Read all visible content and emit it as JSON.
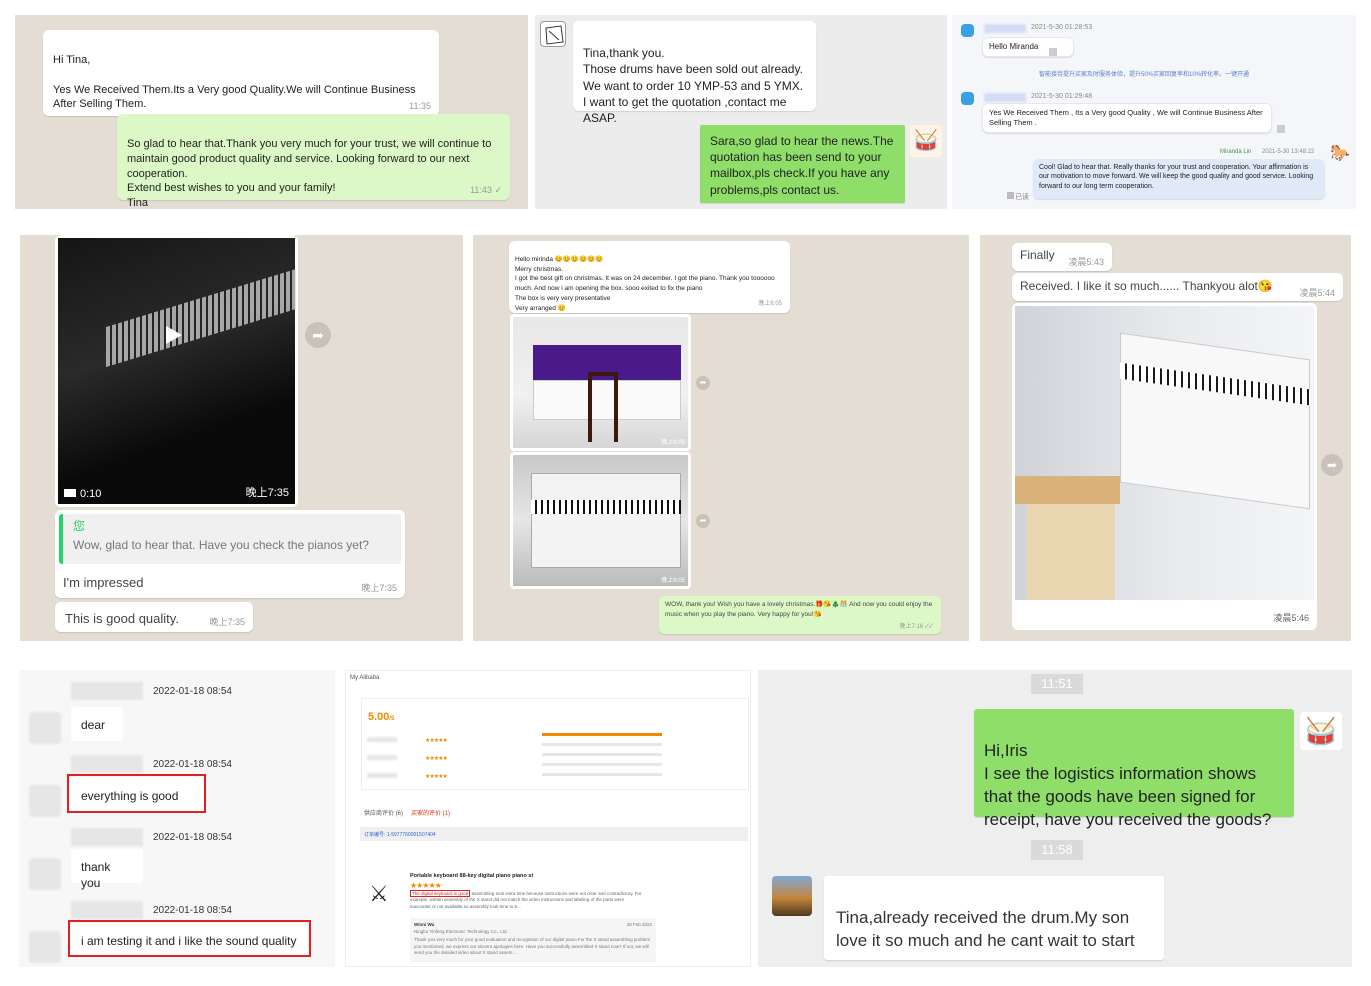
{
  "p1": {
    "in_text": "Hi Tina,\n\nYes We Received Them.Its a Very good Quality.We will Continue Business After Selling Them.",
    "in_time": "11:35",
    "out_text": "So glad to hear that.Thank you very much for your trust, we will continue to maintain good product quality and service. Looking forward to our next cooperation.\nExtend best wishes to you and your family!\nTina",
    "out_time": "11:43 ✓"
  },
  "p2": {
    "in_text": "Tina,thank you.\nThose drums have been sold out already.\nWe want to order 10 YMP-53 and 5 YMX.\nI want to get the quotation ,contact me ASAP.",
    "out_text": "Sara,so glad to hear the news.The quotation has been send to your mailbox,pls check.If you have any problems,pls contact us."
  },
  "p3": {
    "t1": "2021-5-30 01:28:53",
    "m1": "Hello Miranda",
    "note": "智能接待提升买家及时服务体验，提升50%买家回复率和10%转化率。一键开通",
    "t2": "2021-5-30 01:29:48",
    "m2": "Yes We Received Them , Its a Very good Quality , We will Continue Business After Selling Them .",
    "reply_name": "Miranda Lin",
    "t3": "2021-5-30 13:48:22",
    "reply": "Cool! Glad to hear that. Really thanks for your trust and cooperation. Your affirmation is our motivation to move forward. We will keep the good quality and good service. Looking forward to our long term cooperation.",
    "read": "已读"
  },
  "p4": {
    "duration": "0:10",
    "video_time": "晚上7:35",
    "quote_name": "您",
    "quote_text": "Wow, glad to hear that. Have you check the pianos yet?",
    "reply1": "I'm impressed",
    "reply1_time": "晚上7:35",
    "reply2": "This is good quality.",
    "reply2_time": "晚上7:35"
  },
  "p5": {
    "msg": "Hello mirinda 😊😊😊😊😊😊\nMerry christmas.\nI got the best gift on christmas. It was on 24 december. I got the piano. Thank you toooooo much. And now i am opening the box. sooo exited to fix the piano\nThe box is very very presentative\nVery arranged 😊",
    "msg_time": "晚上6:05",
    "img1_time": "晚上6:05",
    "img2_time": "晚上6:05",
    "out": "WOW, thank you! Wish you have a lovely christmas.🎁😘🎄🎊 And now you could enjoy the music when you play the piano. Very happy for you!😘",
    "out_time": "晚上7:16 ✓✓"
  },
  "p6": {
    "m1": "Finally",
    "m1_time": "凌晨5:43",
    "m2": "Received. I like it so much...... Thankyou alot😘",
    "m2_time": "凌晨5:44",
    "img_time": "凌晨5:46"
  },
  "p7": {
    "rows": [
      {
        "time": "2022-01-18 08:54",
        "msg": "dear"
      },
      {
        "time": "2022-01-18 08:54",
        "msg": "everything is good"
      },
      {
        "time": "2022-01-18 08:54",
        "msg": "thank you"
      },
      {
        "time": "2022-01-18 08:54",
        "msg": "i am testing it and i like the sound quality"
      }
    ]
  },
  "p8": {
    "header": "My Alibaba",
    "score": "5.00",
    "score_unit": "/5",
    "tab1": "供应商评价 (6)",
    "tab2": "买家的评价 (1)",
    "order_label": "订单编号: 1-5977760001507404",
    "product": "Portable keyboard 88-key digital piano piano st",
    "review": "The digital keyboard is good",
    "review_rest": "assembling took extra time because instructions were not clear and contradictory. For example, written assembly of the X stand did not match the video instructions and labeling of the parts were inaccurate or not available so assembly took time to 5...",
    "seller": "Winni Wu",
    "date": "28 Feb 2022",
    "company": "Ningbo Yinfeng Electronic Technology Co., Ltd.",
    "reply": "Thank you very much for your good evaluation and recognition of our digital piano.For the X stand assembling problem you mentioned, we express our sincere apologies here. Have you successfully assembled X stand now? If not, we will send you the detailed video about X stand assem..."
  },
  "p9": {
    "time1": "11:51",
    "out": "Hi,Iris\nI see the logistics information shows that the goods have been signed for receipt, have you received the goods?",
    "time2": "11:58",
    "in": "Tina,already received the drum.My son love it so much and he cant wait to start\n."
  }
}
